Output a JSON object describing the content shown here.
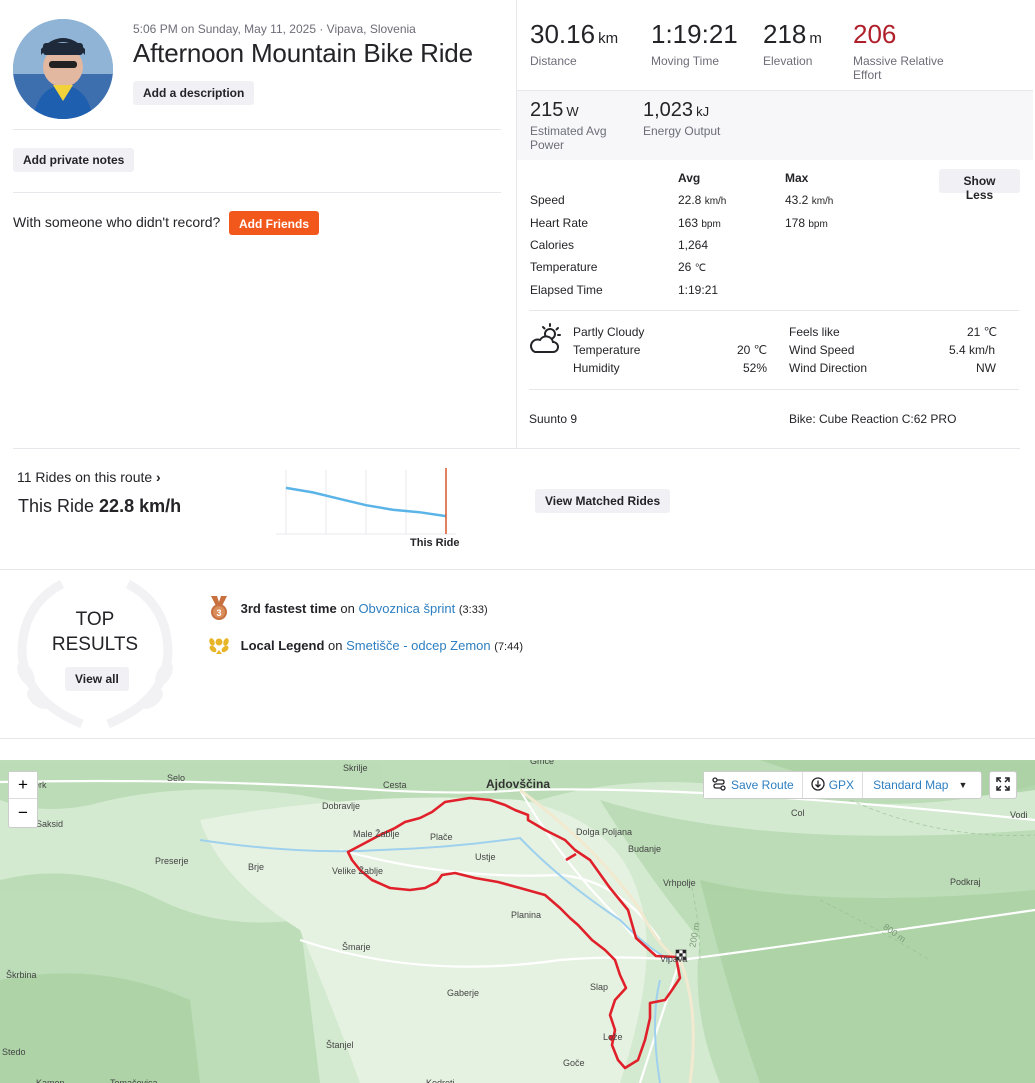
{
  "activity": {
    "datetime_location": "5:06 PM on Sunday, May 11, 2025 · Vipava, Slovenia",
    "title": "Afternoon Mountain Bike Ride",
    "add_description": "Add a description",
    "add_private_notes": "Add private notes",
    "friends_prompt": "With someone who didn't record?",
    "add_friends": "Add Friends"
  },
  "stats_top": [
    {
      "value": "30.16",
      "unit": "km",
      "label": "Distance"
    },
    {
      "value": "1:19:21",
      "unit": "",
      "label": "Moving Time"
    },
    {
      "value": "218",
      "unit": "m",
      "label": "Elevation"
    },
    {
      "value": "206",
      "unit": "",
      "label": "Massive Relative Effort",
      "color": "#b0202a"
    }
  ],
  "stats_second": [
    {
      "value": "215",
      "unit": "W",
      "label": "Estimated Avg Power"
    },
    {
      "value": "1,023",
      "unit": "kJ",
      "label": "Energy Output"
    }
  ],
  "details": {
    "header_avg": "Avg",
    "header_max": "Max",
    "show_less": "Show Less",
    "rows": [
      {
        "label": "Speed",
        "avg": "22.8",
        "avg_unit": "km/h",
        "max": "43.2",
        "max_unit": "km/h"
      },
      {
        "label": "Heart Rate",
        "avg": "163",
        "avg_unit": "bpm",
        "max": "178",
        "max_unit": "bpm"
      },
      {
        "label": "Calories",
        "avg": "1,264",
        "avg_unit": "",
        "max": "",
        "max_unit": ""
      },
      {
        "label": "Temperature",
        "avg": "26",
        "avg_unit": "℃",
        "max": "",
        "max_unit": ""
      },
      {
        "label": "Elapsed Time",
        "avg": "1:19:21",
        "avg_unit": "",
        "max": "",
        "max_unit": ""
      }
    ]
  },
  "weather": {
    "condition": "Partly Cloudy",
    "temp_label": "Temperature",
    "temp_value": "20 ℃",
    "humidity_label": "Humidity",
    "humidity_value": "52%",
    "feels_label": "Feels like",
    "feels_value": "21 ℃",
    "wind_speed_label": "Wind Speed",
    "wind_speed_value": "5.4 km/h",
    "wind_dir_label": "Wind Direction",
    "wind_dir_value": "NW"
  },
  "gear": {
    "device": "Suunto 9",
    "bike": "Bike: Cube Reaction C:62 PRO"
  },
  "matched": {
    "rides_link": "11 Rides on this route",
    "this_ride_prefix": "This Ride",
    "this_ride_value": "22.8 km/h",
    "marker_label": "This Ride",
    "view_button": "View Matched Rides",
    "trend": [
      0.28,
      0.35,
      0.45,
      0.55,
      0.62,
      0.66,
      0.72
    ]
  },
  "top_results": {
    "title_line1": "TOP",
    "title_line2": "RESULTS",
    "view_all": "View all",
    "items": [
      {
        "bold": "3rd fastest time",
        "on": "on",
        "segment": "Obvoznica šprint",
        "time": "(3:33)",
        "icon": "bronze-medal-icon"
      },
      {
        "bold": "Local Legend",
        "on": "on",
        "segment": "Smetišče - odcep Zemon",
        "time": "(7:44)",
        "icon": "laurel-icon"
      }
    ]
  },
  "map": {
    "zoom_in": "+",
    "zoom_out": "−",
    "save_route": "Save Route",
    "gpx": "GPX",
    "map_type": "Standard Map",
    "route_color": "#e0202a",
    "places": [
      "Selo",
      "Skrilje",
      "Cesta",
      "Ajdovščina",
      "Dobravlje",
      "Male Žablje",
      "Plače",
      "Dolga Poljana",
      "Budanje",
      "Col",
      "Saksid",
      "Preserje",
      "Brje",
      "Velike Žablje",
      "Ustje",
      "Vrhpolje",
      "Podkraj",
      "Planina",
      "Vipava",
      "Šmarje",
      "Škrbina",
      "Slap",
      "Gaberje",
      "Lože",
      "Štanjel",
      "Goče",
      "Vodi",
      "Kamen",
      "Tomačevica",
      "Kodreti",
      "Gmče",
      "erk",
      "Stedo"
    ],
    "contours": [
      "200 m",
      "800 m"
    ]
  }
}
